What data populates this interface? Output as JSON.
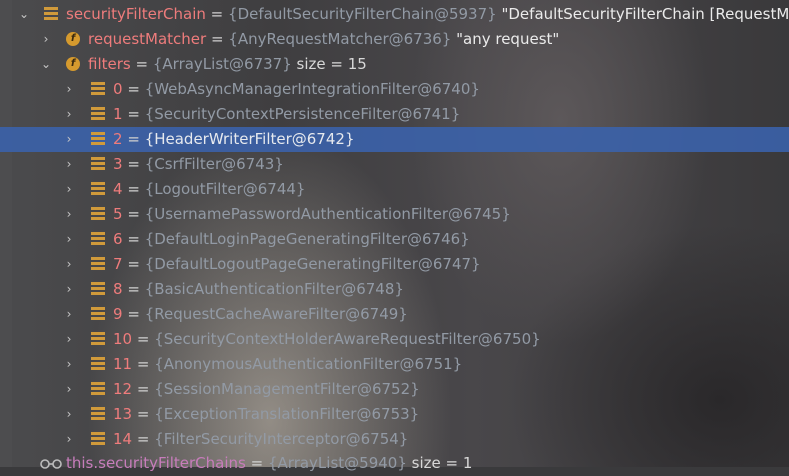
{
  "root": {
    "name": "securityFilterChain",
    "ref": "{DefaultSecurityFilterChain@5937}",
    "string": "\"DefaultSecurityFilterChain [RequestMa"
  },
  "requestMatcher": {
    "name": "requestMatcher",
    "ref": "{AnyRequestMatcher@6736}",
    "string": "\"any request\""
  },
  "filters": {
    "name": "filters",
    "ref": "{ArrayList@6737}",
    "size": "size = 15",
    "items": [
      {
        "index": "0",
        "ref": "{WebAsyncManagerIntegrationFilter@6740}"
      },
      {
        "index": "1",
        "ref": "{SecurityContextPersistenceFilter@6741}"
      },
      {
        "index": "2",
        "ref": "{HeaderWriterFilter@6742}"
      },
      {
        "index": "3",
        "ref": "{CsrfFilter@6743}"
      },
      {
        "index": "4",
        "ref": "{LogoutFilter@6744}"
      },
      {
        "index": "5",
        "ref": "{UsernamePasswordAuthenticationFilter@6745}"
      },
      {
        "index": "6",
        "ref": "{DefaultLoginPageGeneratingFilter@6746}"
      },
      {
        "index": "7",
        "ref": "{DefaultLogoutPageGeneratingFilter@6747}"
      },
      {
        "index": "8",
        "ref": "{BasicAuthenticationFilter@6748}"
      },
      {
        "index": "9",
        "ref": "{RequestCacheAwareFilter@6749}"
      },
      {
        "index": "10",
        "ref": "{SecurityContextHolderAwareRequestFilter@6750}"
      },
      {
        "index": "11",
        "ref": "{AnonymousAuthenticationFilter@6751}"
      },
      {
        "index": "12",
        "ref": "{SessionManagementFilter@6752}"
      },
      {
        "index": "13",
        "ref": "{ExceptionTranslationFilter@6753}"
      },
      {
        "index": "14",
        "ref": "{FilterSecurityInterceptor@6754}"
      }
    ]
  },
  "watch": {
    "name": "this.securityFilterChains",
    "ref": "{ArrayList@5940}",
    "size": "size = 1"
  },
  "selected_index": 2,
  "colors": {
    "selection": "#3b62aa",
    "field_name": "#ee7c7c",
    "reference": "#929aa5",
    "icon": "#d09a3b"
  }
}
